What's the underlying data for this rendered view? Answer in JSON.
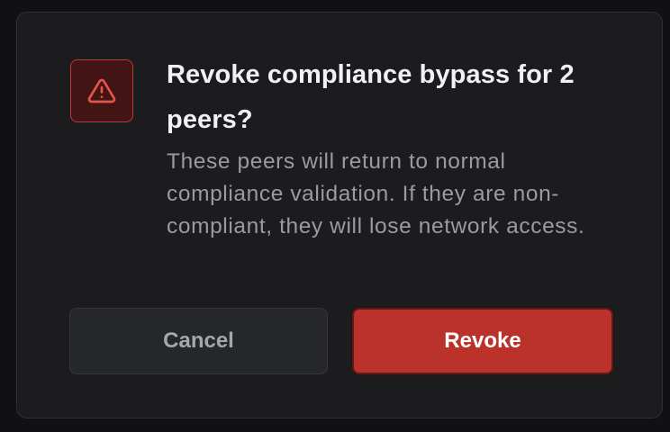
{
  "dialog": {
    "icon": "alert-triangle-icon",
    "title": "Revoke compliance bypass for 2 peers?",
    "message": "These peers will return to normal compliance validation. If they are non-compliant, they will lose network access.",
    "cancel_label": "Cancel",
    "confirm_label": "Revoke"
  },
  "colors": {
    "danger": "#bb322b",
    "icon_background": "#421414",
    "dialog_background": "#1c1c1f"
  }
}
